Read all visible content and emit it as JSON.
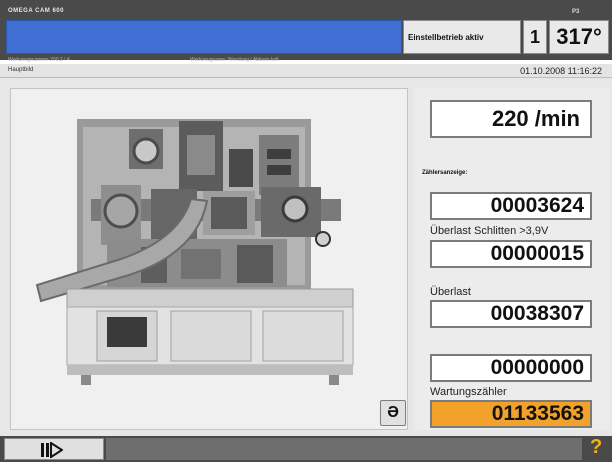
{
  "header": {
    "brand": "OMEGA CAM 600",
    "mode": "Einstellbetrieb aktiv",
    "counter": "1",
    "angle_label": "P3",
    "angle": "317°"
  },
  "info_line": {
    "left": "Werkzeugnummer 200.2 / 4",
    "right": "Werkzeugname: Wendung | Abkreis kalt"
  },
  "breadcrumb": {
    "page": "Hauptbild",
    "datetime": "01.10.2008 11:16:22"
  },
  "speed": "220 /min",
  "counters": {
    "title": "Zählersanzeige:",
    "items": [
      {
        "label": "",
        "value": "00003624",
        "highlight": false
      },
      {
        "label": "Überlast Schlitten >3,9V",
        "value": "00000015",
        "highlight": false
      },
      {
        "label": "Überlast",
        "value": "00038307",
        "highlight": false
      },
      {
        "label": "",
        "value": "00000000",
        "highlight": false
      },
      {
        "label": "Wartungszähler",
        "value": "01133563",
        "highlight": true
      }
    ]
  },
  "buttons": {
    "return_icon": "return-icon",
    "play_icon": "step-forward-icon",
    "help_icon": "help-icon",
    "return_glyph": "Ə",
    "help_glyph": "?"
  },
  "colors": {
    "message_blue": "#3f6fd2",
    "highlight_orange": "#f2a22b",
    "chrome_dark": "#4a4a4a",
    "help_yellow": "#f0b020"
  }
}
